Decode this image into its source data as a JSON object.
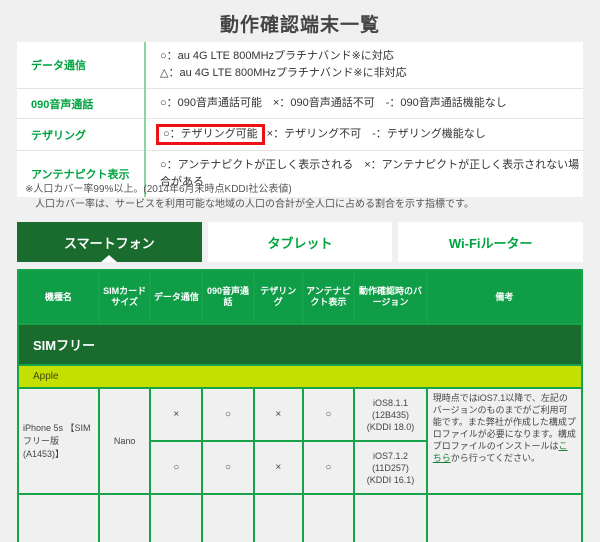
{
  "page": {
    "title": "動作確認端末一覧"
  },
  "legend": {
    "rows": [
      {
        "label": "データ通信",
        "lines": [
          "○：au 4G LTE 800MHzプラチナバンド※に対応",
          "△：au 4G LTE 800MHzプラチナバンド※に非対応"
        ]
      },
      {
        "label": "090音声通話",
        "lines": [
          "○：090音声通話可能　×：090音声通話不可　-：090音声通話機能なし"
        ]
      },
      {
        "label": "テザリング",
        "highlighted": "○：テザリング可能",
        "rest": "×：テザリング不可　-：テザリング機能なし"
      },
      {
        "label": "アンテナピクト表示",
        "lines": [
          "○：アンテナピクトが正しく表示される　×：アンテナピクトが正しく表示されない場合がある"
        ]
      }
    ]
  },
  "footnote": {
    "line1": "※人口カバー率99%以上。(2014年6月末時点KDDI社公表値)",
    "line2": "人口カバー率は、サービスを利用可能な地域の人口の合計が全人口に占める割合を示す指標です。"
  },
  "tabs": [
    {
      "label": "スマートフォン",
      "active": true
    },
    {
      "label": "タブレット",
      "active": false
    },
    {
      "label": "Wi-Fiルーター",
      "active": false
    }
  ],
  "table": {
    "headers": [
      "機種名",
      "SIMカードサイズ",
      "データ通信",
      "090音声通話",
      "テザリング",
      "アンテナピクト表示",
      "動作確認時のバージョン",
      "備考"
    ],
    "section": "SIMフリー",
    "subsection": "Apple",
    "device": {
      "model": "iPhone 5s 【SIMフリー版(A1453)】",
      "sim": "Nano",
      "rows": [
        {
          "data": "×",
          "voice": "○",
          "tethering": "×",
          "antenna": "○",
          "version": [
            "iOS8.1.1",
            "(12B435)",
            "(KDDI 18.0)"
          ]
        },
        {
          "data": "○",
          "voice": "○",
          "tethering": "×",
          "antenna": "○",
          "version": [
            "iOS7.1.2",
            "(11D257)",
            "(KDDI 16.1)"
          ]
        }
      ],
      "remark_before": "現時点ではiOS7.1以降で、左記のバージョンのものまでがご利用可能です。また弊社が作成した構成プロファイルが必要になります。構成プロファイルのインストールは",
      "remark_link": "こちら",
      "remark_after": "から行ってください。"
    }
  },
  "colors": {
    "brand_green": "#0f9d48",
    "dark_green": "#1a6b2e",
    "lime": "#c3e000",
    "alert_red": "#ee1111"
  }
}
